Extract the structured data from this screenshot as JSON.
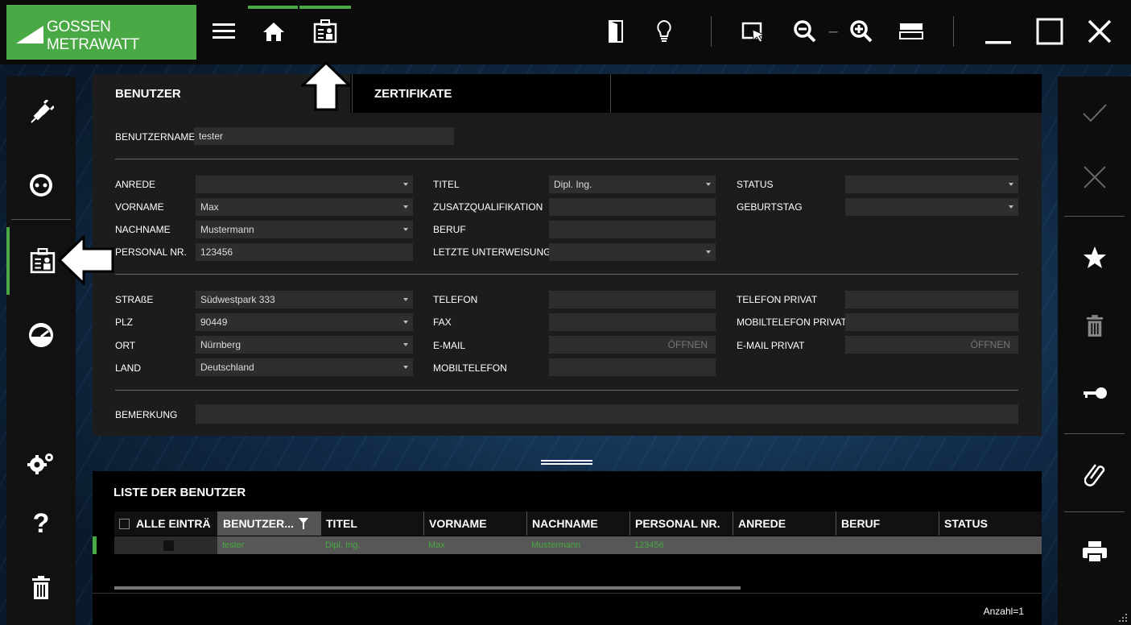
{
  "app": {
    "brand": "GOSSEN METRAWATT",
    "accent_color": "#49a944"
  },
  "toolbar": {
    "left_icons": [
      "menu-icon",
      "home-icon",
      "user-badge-icon"
    ],
    "right_icons": [
      "door-icon",
      "lightbulb-icon",
      "select-cursor-icon",
      "zoom-out-icon",
      "zoom-in-icon",
      "layout-icon",
      "minimize-icon",
      "maximize-icon",
      "close-icon"
    ],
    "zoom_separator": "–"
  },
  "left_sidebar": {
    "items": [
      "plug-icon",
      "socket-icon",
      "user-badge-icon",
      "gauge-icon",
      "settings-icon",
      "help-icon",
      "trash-icon"
    ],
    "active_index": 2
  },
  "right_sidebar": {
    "items": [
      "check-icon",
      "cancel-icon",
      "star-icon",
      "delete-icon",
      "key-icon",
      "attachment-icon",
      "print-icon"
    ]
  },
  "tabs": {
    "users": "BENUTZER",
    "certificates": "ZERTIFIKATE"
  },
  "form": {
    "username_label": "BENUTZERNAME",
    "username_value": "tester",
    "col1": [
      {
        "label": "ANREDE",
        "value": "",
        "dropdown": true
      },
      {
        "label": "VORNAME",
        "value": "Max",
        "dropdown": true
      },
      {
        "label": "NACHNAME",
        "value": "Mustermann",
        "dropdown": true
      },
      {
        "label": "PERSONAL NR.",
        "value": "123456",
        "dropdown": false
      }
    ],
    "col2": [
      {
        "label": "TITEL",
        "value": "Dipl. Ing.",
        "dropdown": true
      },
      {
        "label": "ZUSATZQUALIFIKATION",
        "value": "",
        "dropdown": false
      },
      {
        "label": "BERUF",
        "value": "",
        "dropdown": false
      },
      {
        "label": "LETZTE UNTERWEISUNG",
        "value": "",
        "dropdown": true
      }
    ],
    "col3": [
      {
        "label": "STATUS",
        "value": "",
        "dropdown": true
      },
      {
        "label": "GEBURTSTAG",
        "value": "",
        "dropdown": true
      }
    ],
    "addr_col1": [
      {
        "label": "STRAßE",
        "value": "Südwestpark 333",
        "dropdown": true
      },
      {
        "label": "PLZ",
        "value": "90449",
        "dropdown": true
      },
      {
        "label": "ORT",
        "value": "Nürnberg",
        "dropdown": true
      },
      {
        "label": "LAND",
        "value": "Deutschland",
        "dropdown": true
      }
    ],
    "addr_col2": [
      {
        "label": "TELEFON",
        "value": ""
      },
      {
        "label": "FAX",
        "value": ""
      },
      {
        "label": "E-MAIL",
        "value": "",
        "open_label": "ÖFFNEN"
      },
      {
        "label": "MOBILTELEFON",
        "value": ""
      }
    ],
    "addr_col3": [
      {
        "label": "TELEFON PRIVAT",
        "value": ""
      },
      {
        "label": "MOBILTELEFON PRIVAT",
        "value": ""
      },
      {
        "label": "E-MAIL PRIVAT",
        "value": "",
        "open_label": "ÖFFNEN"
      }
    ],
    "remark_label": "BEMERKUNG",
    "remark_value": ""
  },
  "user_list": {
    "title": "LISTE DER BENUTZER",
    "columns": [
      "ALLE EINTRÄ",
      "BENUTZER...",
      "TITEL",
      "VORNAME",
      "NACHNAME",
      "PERSONAL NR.",
      "ANREDE",
      "BERUF",
      "STATUS"
    ],
    "rows": [
      {
        "selected": false,
        "username": "tester",
        "title": "Dipl. Ing.",
        "first_name": "Max",
        "last_name": "Mustermann",
        "personnel_no": "123456",
        "salutation": "",
        "job": "",
        "status": ""
      }
    ],
    "count_label": "Anzahl=1"
  }
}
